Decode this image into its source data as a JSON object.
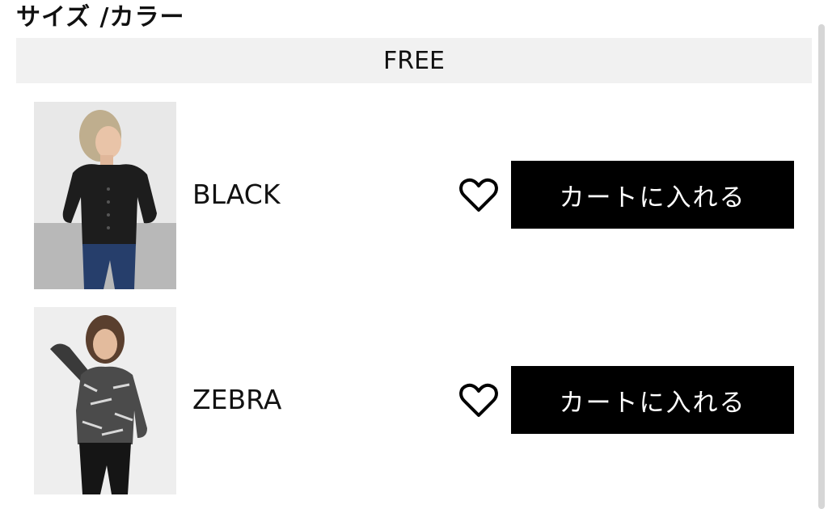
{
  "section": {
    "title": "サイズ /カラー"
  },
  "size": {
    "label": "FREE"
  },
  "products": [
    {
      "color": "BLACK",
      "cart_label": "カートに入れる",
      "fav_icon": "heart-outline-icon"
    },
    {
      "color": "ZEBRA",
      "cart_label": "カートに入れる",
      "fav_icon": "heart-outline-icon"
    }
  ],
  "colors": {
    "button_bg": "#000000",
    "button_text": "#ffffff",
    "size_bar_bg": "#f1f1f1"
  }
}
